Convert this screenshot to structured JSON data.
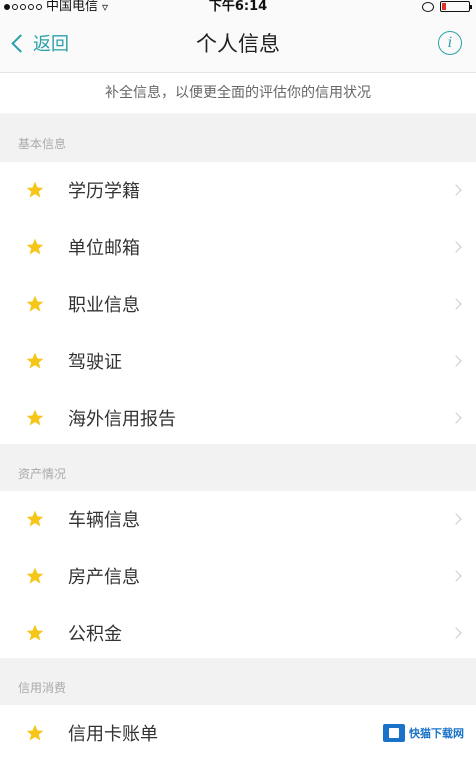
{
  "status_bar": {
    "carrier": "中国电信",
    "time": "下午6:14"
  },
  "nav": {
    "back_label": "返回",
    "title": "个人信息",
    "info_symbol": "i"
  },
  "notice": "补全信息，以便更全面的评估你的信用状况",
  "sections": [
    {
      "header": "基本信息",
      "items": [
        "学历学籍",
        "单位邮箱",
        "职业信息",
        "驾驶证",
        "海外信用报告"
      ]
    },
    {
      "header": "资产情况",
      "items": [
        "车辆信息",
        "房产信息",
        "公积金"
      ]
    },
    {
      "header": "信用消费",
      "items": [
        "信用卡账单"
      ]
    }
  ],
  "watermark": "快猫下载网",
  "colors": {
    "accent": "#2aa1a8",
    "star": "#f5c518",
    "battery": "#e0302a"
  }
}
